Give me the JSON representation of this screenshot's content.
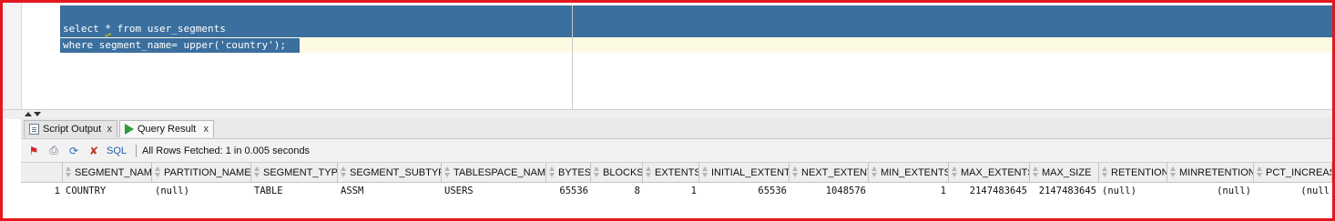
{
  "editor": {
    "line1_pre": "select ",
    "line1_star": "*",
    "line1_post": " from user_segments",
    "line2": "where segment_name= upper('country');"
  },
  "tabs": [
    {
      "label": "Script Output",
      "close": "x",
      "icon": "document-icon"
    },
    {
      "label": "Query Result",
      "close": "x",
      "icon": "run-icon"
    }
  ],
  "toolbar": {
    "sql_label": "SQL",
    "status": "All Rows Fetched: 1 in 0.005 seconds"
  },
  "grid": {
    "columns": [
      "SEGMENT_NAME",
      "PARTITION_NAME",
      "SEGMENT_TYPE",
      "SEGMENT_SUBTYPE",
      "TABLESPACE_NAME",
      "BYTES",
      "BLOCKS",
      "EXTENTS",
      "INITIAL_EXTENT",
      "NEXT_EXTENT",
      "MIN_EXTENTS",
      "MAX_EXTENTS",
      "MAX_SIZE",
      "RETENTION",
      "MINRETENTION",
      "PCT_INCREASE"
    ],
    "rows": [
      {
        "num": "1",
        "cells": [
          "COUNTRY",
          "(null)",
          "TABLE",
          "ASSM",
          "USERS",
          "65536",
          "8",
          "1",
          "65536",
          "1048576",
          "1",
          "2147483645",
          "2147483645",
          "(null)",
          "(null)",
          "(null"
        ]
      }
    ]
  },
  "colors": {
    "selection": "#3a6f9e",
    "frame": "#e3171e",
    "current_line": "#fdfae4"
  }
}
